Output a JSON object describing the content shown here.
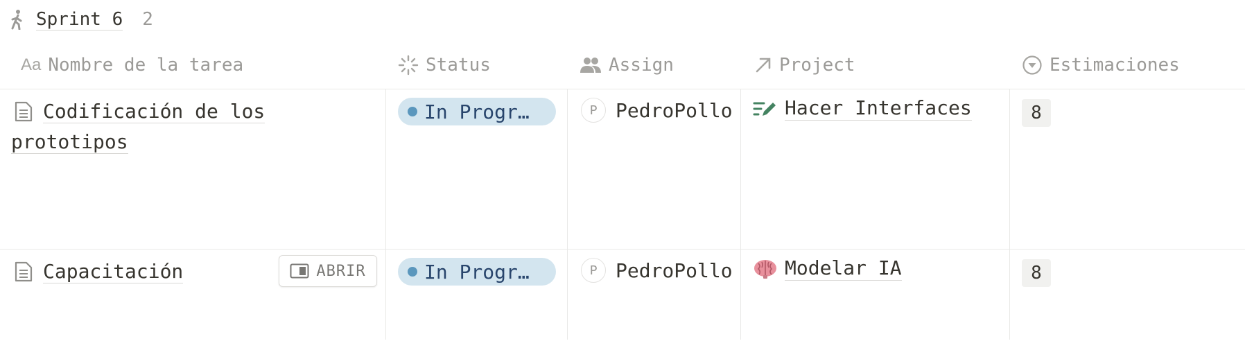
{
  "group": {
    "icon": "person-walking-icon",
    "title": "Sprint 6",
    "count": "2"
  },
  "columns": {
    "name": {
      "icon": "text-aa-icon",
      "label": "Nombre de la tarea"
    },
    "status": {
      "icon": "loading-sun-icon",
      "label": "Status"
    },
    "assign": {
      "icon": "people-icon",
      "label": "Assign"
    },
    "project": {
      "icon": "arrow-up-right-icon",
      "label": "Project"
    },
    "estim": {
      "icon": "select-chevron-icon",
      "label": "Estimaciones"
    }
  },
  "rows": [
    {
      "title_line1": "Codificación de los ",
      "title_line2": "prototipos",
      "status": "In Progr…",
      "assign_initial": "P",
      "assign_name": "PedroPollo",
      "project_icon": "pencil-lines-icon",
      "project_name": "Hacer Interfaces",
      "estimacion": "8"
    },
    {
      "title": "Capacitación",
      "open_label": "ABRIR",
      "status": "In Progr…",
      "assign_initial": "P",
      "assign_name": "PedroPollo",
      "project_icon": "brain-icon",
      "project_name": "Modelar IA",
      "estimacion": "8"
    }
  ],
  "colors": {
    "status_bg": "#d3e5ef",
    "status_dot": "#5b97bd",
    "project_icon_green": "#448361"
  }
}
